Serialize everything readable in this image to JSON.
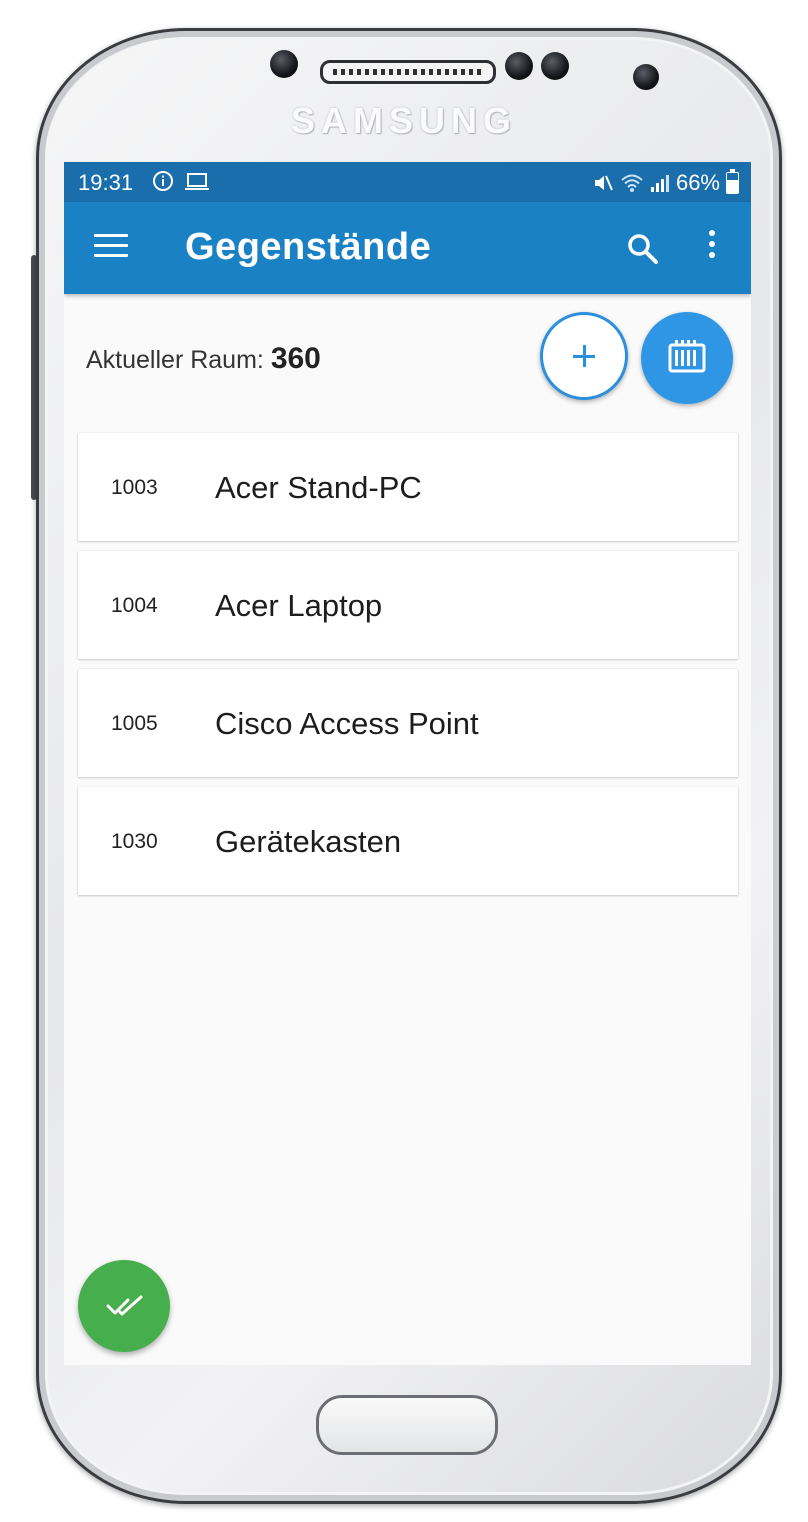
{
  "device": {
    "brand": "SAMSUNG"
  },
  "statusbar": {
    "time": "19:31",
    "left_icons": [
      "info-icon",
      "laptop-icon"
    ],
    "right_icons": [
      "mute-icon",
      "wifi-icon",
      "signal-icon",
      "battery-icon"
    ],
    "battery": "66%"
  },
  "appbar": {
    "title": "Gegenstände",
    "color": "#1a82c4",
    "status_color": "#1a6eac"
  },
  "room": {
    "label": "Aktueller Raum:",
    "number": "360"
  },
  "items": [
    {
      "id": "1003",
      "name": "Acer Stand-PC"
    },
    {
      "id": "1004",
      "name": "Acer Laptop"
    },
    {
      "id": "1005",
      "name": "Cisco Access Point"
    },
    {
      "id": "1030",
      "name": "Gerätekasten"
    }
  ],
  "colors": {
    "accent": "#2f96e6",
    "confirm": "#47ae4d"
  }
}
